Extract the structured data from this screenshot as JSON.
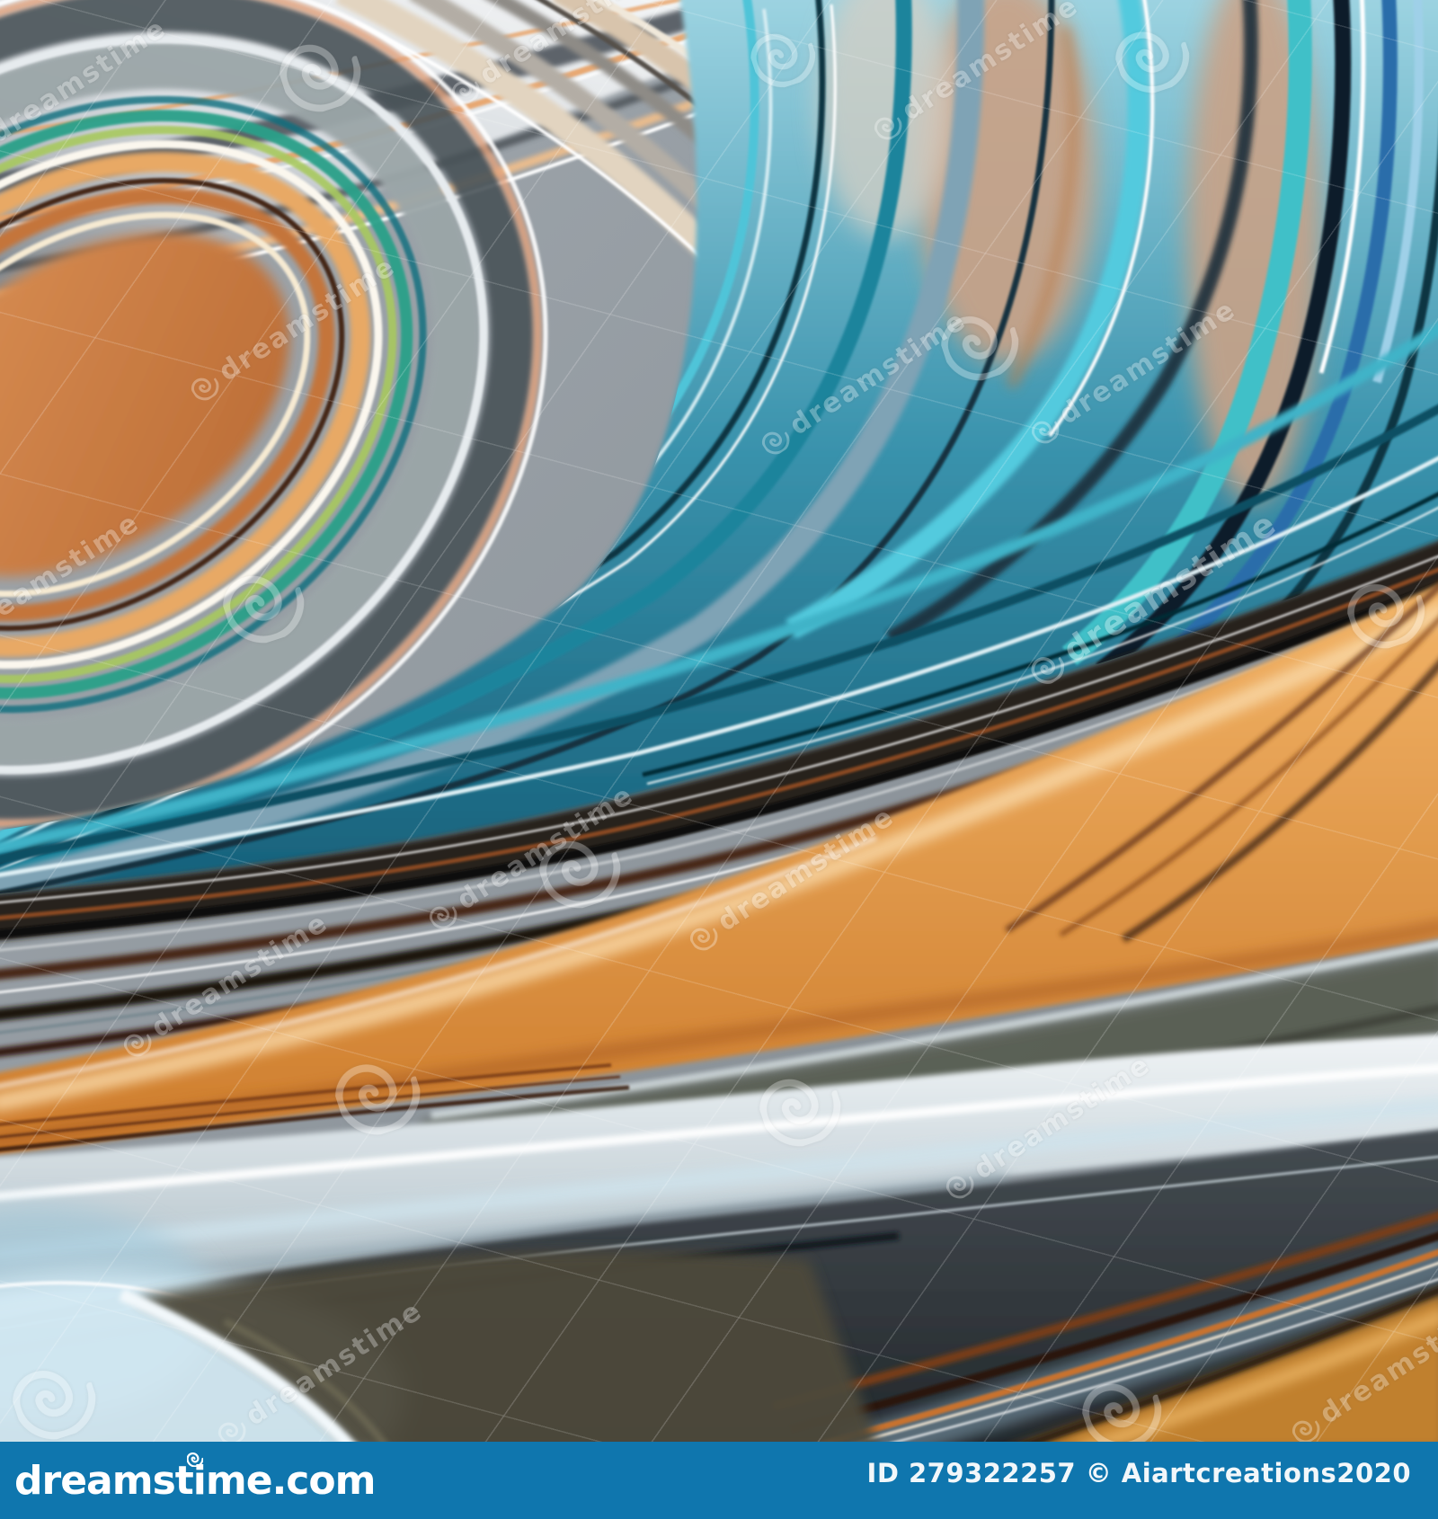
{
  "watermark": {
    "brand": "dreamstime"
  },
  "footer": {
    "logo": "dreamstime.com",
    "credit": "ID 279322257 © Aiartcreations2020",
    "bar_color": "#0f76ae"
  },
  "palette": {
    "teal": "#1d849c",
    "turquoise": "#4fc4d8",
    "dark_teal": "#083442",
    "steel_blue": "#7fa3b5",
    "orange": "#e8a450",
    "copper": "#b4622a",
    "dark_brown": "#472818",
    "silver": "#ccd5da",
    "champagne": "#ded0bc",
    "charcoal": "#23282c",
    "light_blue": "#d5ebf5"
  },
  "icons": {
    "watermark_spiral": "spiral-icon",
    "logo_spiral": "logo-spiral-icon"
  }
}
